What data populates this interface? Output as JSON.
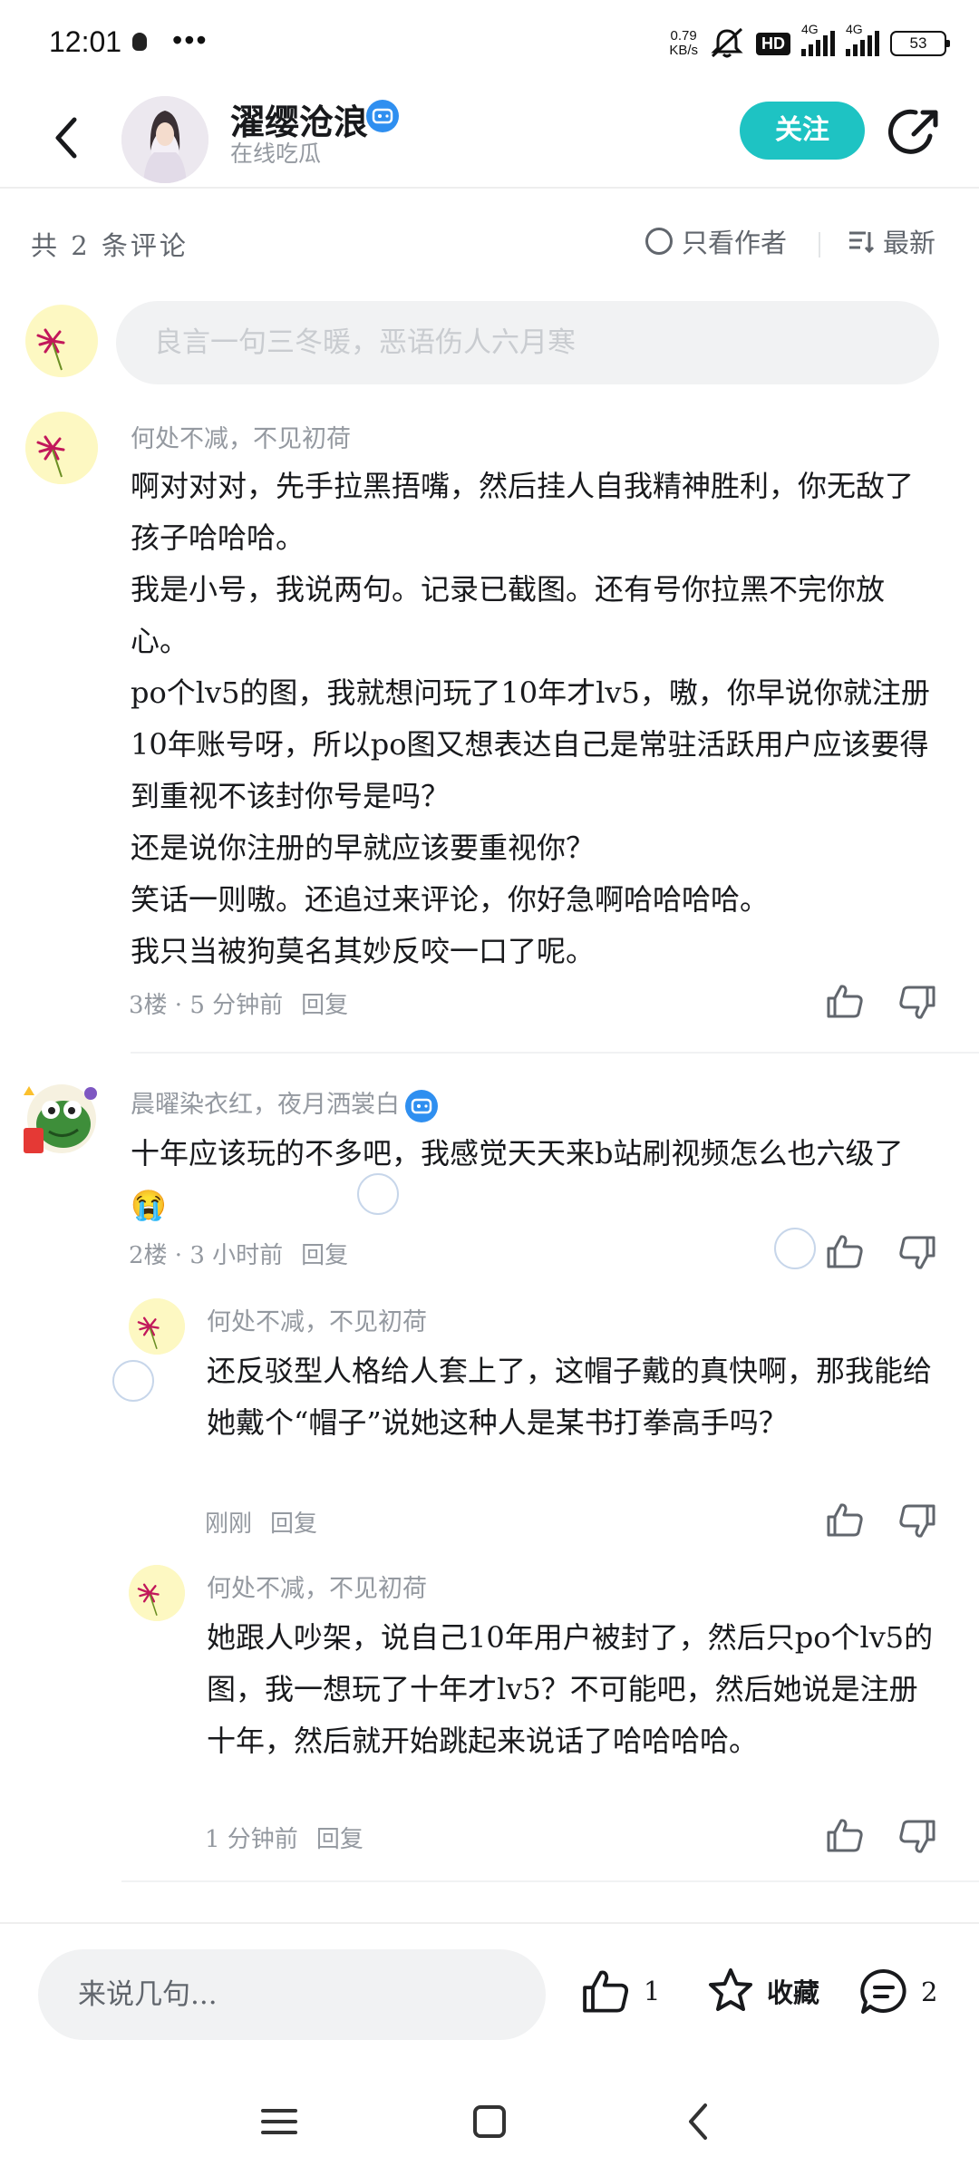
{
  "status_bar": {
    "time": "12:01",
    "dots": "•••",
    "net_speed_value": "0.79",
    "net_speed_unit": "KB/s",
    "hd_label": "HD",
    "signal1_label": "4G",
    "signal2_label": "4G",
    "battery": "53"
  },
  "header": {
    "title": "濯缨沧浪",
    "subtitle": "在线吃瓜",
    "follow_label": "关注"
  },
  "filter": {
    "count_label": "共 2 条评论",
    "author_only_label": "只看作者",
    "sort_label": "最新"
  },
  "composer": {
    "placeholder": "良言一句三冬暖，恶语伤人六月寒"
  },
  "comments": [
    {
      "user": "何处不减，不见初荷",
      "paragraphs": [
        "啊对对对，先手拉黑捂嘴，然后挂人自我精神胜利，你无敌了孩子哈哈哈。",
        "我是小号，我说两句。记录已截图。还有号你拉黑不完你放心。",
        "po个lv5的图，我就想问玩了10年才lv5，嗷，你早说你就注册10年账号呀，所以po图又想表达自己是常驻活跃用户应该要得到重视不该封你号是吗？",
        "还是说你注册的早就应该要重视你？",
        "笑话一则嗷。还追过来评论，你好急啊哈哈哈哈。",
        "我只当被狗莫名其妙反咬一口了呢。"
      ],
      "meta": "3楼 · 5 分钟前",
      "reply_label": "回复"
    },
    {
      "user": "晨曜染衣红，夜月洒裳白",
      "text": "十年应该玩的不多吧，我感觉天天来b站刷视频怎么也六级了😭",
      "meta": "2楼 · 3 小时前",
      "reply_label": "回复",
      "replies": [
        {
          "user": "何处不减，不见初荷",
          "text": "还反驳型人格给人套上了，这帽子戴的真快啊，那我能给她戴个“帽子”说她这种人是某书打拳高手吗？",
          "meta": "刚刚",
          "reply_label": "回复"
        },
        {
          "user": "何处不减，不见初荷",
          "text": "她跟人吵架，说自己10年用户被封了，然后只po个lv5的图，我一想玩了十年才lv5？不可能吧，然后她说是注册十年，然后就开始跳起来说话了哈哈哈哈。",
          "meta": "1 分钟前",
          "reply_label": "回复"
        }
      ]
    }
  ],
  "bottom_bar": {
    "input_placeholder": "来说几句...",
    "like_count": "1",
    "favorite_label": "收藏",
    "comment_count": "2"
  },
  "colors": {
    "accent": "#1ec3c3",
    "verify": "#2f8ff0",
    "muted_text": "#9499a0"
  }
}
